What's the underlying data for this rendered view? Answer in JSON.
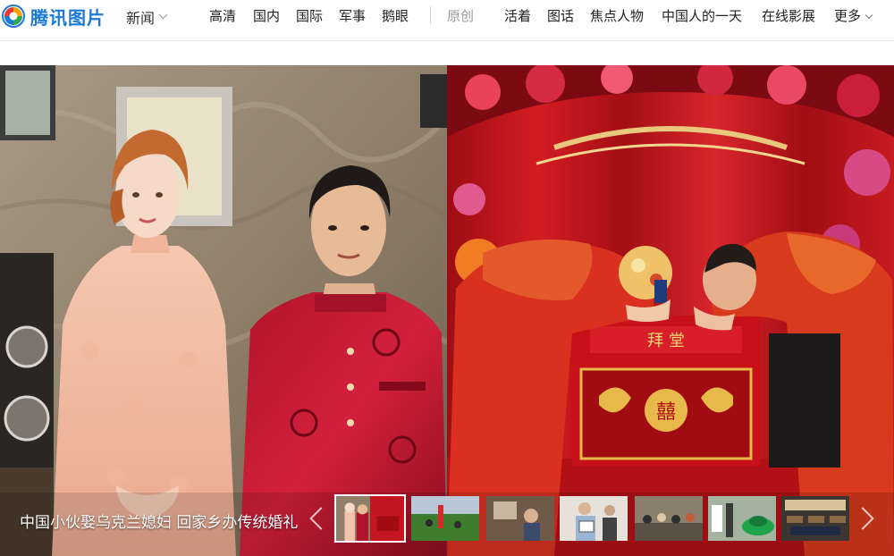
{
  "header": {
    "logo_text": "腾讯图片",
    "section_label": "新闻",
    "nav_items": [
      {
        "label": "高清"
      },
      {
        "label": "国内"
      },
      {
        "label": "国际"
      },
      {
        "label": "军事"
      },
      {
        "label": "鹅眼"
      },
      {
        "label": "原创"
      },
      {
        "label": "活着"
      },
      {
        "label": "图话"
      },
      {
        "label": "焦点人物"
      },
      {
        "label": "中国人的一天"
      },
      {
        "label": "在线影展"
      },
      {
        "label": "更多"
      }
    ]
  },
  "gallery": {
    "caption": "中国小伙娶乌克兰媳妇 回家乡办传统婚礼",
    "thumbnails": [
      {
        "subject": "wedding-couple",
        "active": true
      },
      {
        "subject": "field-with-people",
        "active": false
      },
      {
        "subject": "indoor-people",
        "active": false
      },
      {
        "subject": "woman-holding-sign",
        "active": false
      },
      {
        "subject": "crowd-gathering",
        "active": false
      },
      {
        "subject": "street-and-green-car",
        "active": false
      },
      {
        "subject": "classroom-desks",
        "active": false
      }
    ]
  },
  "colors": {
    "brand_blue": "#1b79d8",
    "nav_text": "#222222",
    "nav_muted": "#999999",
    "wedding_red": "#c8161d"
  },
  "icons": {
    "logo": "tencent-pictures-logo-icon",
    "dropdown": "chevron-down-icon",
    "prev": "chevron-left-icon",
    "next": "chevron-right-icon"
  }
}
